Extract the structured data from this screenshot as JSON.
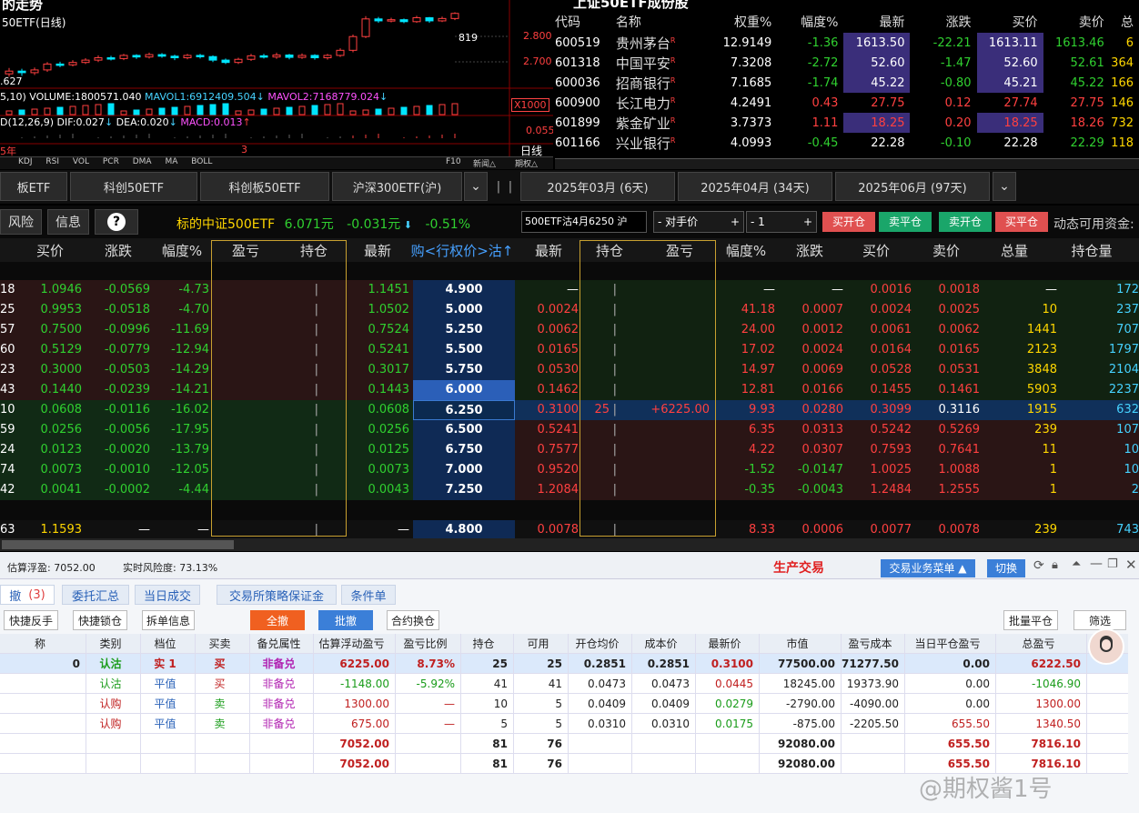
{
  "chart": {
    "title": "的走势",
    "subtitle": "50ETF(日线)",
    "price_labels": [
      "2.800",
      "2.700"
    ],
    "last_price_tag": "819",
    "low_label": ".627",
    "volume_text": "5,10) VOLUME:1800571.040",
    "mavol1_text": "MAVOL1:6912409.504",
    "mavol2_text": "MAVOL2:7168779.024",
    "multiplier": "X1000",
    "macd_prefix": "D(12,26,9)",
    "dif_text": "DIF:0.027",
    "dea_text": "DEA:0.020",
    "macd_text": "MACD:0.013",
    "macd_level": "0.055",
    "year_label": "5年",
    "month_label": "3",
    "period_label": "日线",
    "indicator_tabs": [
      "KDJ",
      "RSI",
      "VOL",
      "PCR",
      "DMA",
      "MA",
      "BOLL"
    ],
    "f10_label": "F10",
    "news_label": "新闻△",
    "period_btn": "期权△",
    "candles": [
      {
        "o": 2.665,
        "c": 2.672,
        "h": 2.68,
        "l": 2.658
      },
      {
        "o": 2.672,
        "c": 2.668,
        "h": 2.678,
        "l": 2.66
      },
      {
        "o": 2.668,
        "c": 2.675,
        "h": 2.681,
        "l": 2.662
      },
      {
        "o": 2.675,
        "c": 2.69,
        "h": 2.695,
        "l": 2.67
      },
      {
        "o": 2.69,
        "c": 2.688,
        "h": 2.696,
        "l": 2.682
      },
      {
        "o": 2.688,
        "c": 2.694,
        "h": 2.7,
        "l": 2.684
      },
      {
        "o": 2.694,
        "c": 2.7,
        "h": 2.705,
        "l": 2.69
      },
      {
        "o": 2.7,
        "c": 2.706,
        "h": 2.712,
        "l": 2.695
      },
      {
        "o": 2.706,
        "c": 2.704,
        "h": 2.711,
        "l": 2.699
      },
      {
        "o": 2.704,
        "c": 2.712,
        "h": 2.716,
        "l": 2.7
      },
      {
        "o": 2.712,
        "c": 2.708,
        "h": 2.715,
        "l": 2.703
      },
      {
        "o": 2.708,
        "c": 2.714,
        "h": 2.719,
        "l": 2.704
      },
      {
        "o": 2.714,
        "c": 2.71,
        "h": 2.718,
        "l": 2.706
      },
      {
        "o": 2.71,
        "c": 2.706,
        "h": 2.714,
        "l": 2.7
      },
      {
        "o": 2.706,
        "c": 2.712,
        "h": 2.716,
        "l": 2.702
      },
      {
        "o": 2.712,
        "c": 2.709,
        "h": 2.716,
        "l": 2.704
      },
      {
        "o": 2.709,
        "c": 2.7,
        "h": 2.712,
        "l": 2.695
      },
      {
        "o": 2.7,
        "c": 2.694,
        "h": 2.704,
        "l": 2.69
      },
      {
        "o": 2.694,
        "c": 2.702,
        "h": 2.706,
        "l": 2.69
      },
      {
        "o": 2.702,
        "c": 2.711,
        "h": 2.716,
        "l": 2.698
      },
      {
        "o": 2.711,
        "c": 2.708,
        "h": 2.716,
        "l": 2.704
      },
      {
        "o": 2.708,
        "c": 2.713,
        "h": 2.719,
        "l": 2.703
      },
      {
        "o": 2.713,
        "c": 2.707,
        "h": 2.716,
        "l": 2.702
      },
      {
        "o": 2.707,
        "c": 2.712,
        "h": 2.717,
        "l": 2.703
      },
      {
        "o": 2.712,
        "c": 2.706,
        "h": 2.715,
        "l": 2.701
      },
      {
        "o": 2.706,
        "c": 2.712,
        "h": 2.716,
        "l": 2.701
      },
      {
        "o": 2.712,
        "c": 2.725,
        "h": 2.73,
        "l": 2.708
      },
      {
        "o": 2.725,
        "c": 2.76,
        "h": 2.765,
        "l": 2.72
      },
      {
        "o": 2.76,
        "c": 2.805,
        "h": 2.812,
        "l": 2.756
      },
      {
        "o": 2.805,
        "c": 2.8,
        "h": 2.81,
        "l": 2.795
      },
      {
        "o": 2.8,
        "c": 2.803,
        "h": 2.808,
        "l": 2.796
      },
      {
        "o": 2.803,
        "c": 2.798,
        "h": 2.806,
        "l": 2.794
      },
      {
        "o": 2.798,
        "c": 2.808,
        "h": 2.813,
        "l": 2.795
      },
      {
        "o": 2.808,
        "c": 2.8,
        "h": 2.81,
        "l": 2.795
      },
      {
        "o": 2.8,
        "c": 2.806,
        "h": 2.811,
        "l": 2.797
      },
      {
        "o": 2.806,
        "c": 2.819,
        "h": 2.822,
        "l": 2.802
      }
    ]
  },
  "stocks": {
    "header_title": "上证50ETF成份股",
    "columns": [
      "代码",
      "名称",
      "权重%",
      "幅度%",
      "最新",
      "涨跌",
      "买价",
      "卖价",
      "总"
    ],
    "rows": [
      {
        "code": "600519",
        "name": "贵州茅台",
        "w": "12.9149",
        "amp": "-1.36",
        "last": "1613.50",
        "chg": "-22.21",
        "bid": "1613.11",
        "ask": "1613.46",
        "tot": "6"
      },
      {
        "code": "601318",
        "name": "中国平安",
        "w": "7.3208",
        "amp": "-2.72",
        "last": "52.60",
        "chg": "-1.47",
        "bid": "52.60",
        "ask": "52.61",
        "tot": "364"
      },
      {
        "code": "600036",
        "name": "招商银行",
        "w": "7.1685",
        "amp": "-1.74",
        "last": "45.22",
        "chg": "-0.80",
        "bid": "45.21",
        "ask": "45.22",
        "tot": "166"
      },
      {
        "code": "600900",
        "name": "长江电力",
        "w": "4.2491",
        "amp": "0.43",
        "last": "27.75",
        "chg": "0.12",
        "bid": "27.74",
        "ask": "27.75",
        "tot": "146"
      },
      {
        "code": "601899",
        "name": "紫金矿业",
        "w": "3.7373",
        "amp": "1.11",
        "last": "18.25",
        "chg": "0.20",
        "bid": "18.25",
        "ask": "18.26",
        "tot": "732"
      },
      {
        "code": "601166",
        "name": "兴业银行",
        "w": "4.0993",
        "amp": "-0.45",
        "last": "22.28",
        "chg": "-0.10",
        "bid": "22.28",
        "ask": "22.29",
        "tot": "118"
      }
    ],
    "suffix": "R"
  },
  "tabs2": [
    "板ETF",
    "科创50ETF",
    "科创板50ETF",
    "沪深300ETF(沪)",
    "2025年03月 (6天)",
    "2025年04月 (34天)",
    "2025年06月 (97天)"
  ],
  "toolbar": {
    "risk": "风险",
    "info": "信息",
    "help": "?",
    "underlying_label": "标的",
    "underlying_name": "中证500ETF",
    "underlying_price": "6.071元",
    "underlying_chg": "-0.031元",
    "underlying_pct": "-0.51%",
    "contract": "500ETF沽4月6250 沪",
    "price_mode": "- 对手价",
    "qty": "- 1",
    "buy_open": "买开仓",
    "sell_close": "卖平仓",
    "sell_open": "卖开仓",
    "buy_close": "买平仓",
    "funds": "动态可用资金:"
  },
  "grid": {
    "headers_left": [
      "买价",
      "涨跌",
      "幅度%",
      "盈亏",
      "持仓",
      "最新"
    ],
    "strike_header": "购<行权价>沽↑",
    "headers_right": [
      "最新",
      "持仓",
      "盈亏",
      "幅度%",
      "涨跌",
      "买价",
      "卖价",
      "总量",
      "持仓量"
    ],
    "rows": [
      {
        "cb": "18",
        "b": "1.0946",
        "d": "-0.0569",
        "p": "-4.73",
        "cl": "1.1451",
        "k": "4.900",
        "pl": "—",
        "rp": "—",
        "rd": "—",
        "rb": "0.0016",
        "ra": "0.0018",
        "rv": "—",
        "ro": "172"
      },
      {
        "cb": "25",
        "b": "0.9953",
        "d": "-0.0518",
        "p": "-4.70",
        "cl": "1.0502",
        "k": "5.000",
        "pl": "0.0024",
        "rp": "41.18",
        "rd": "0.0007",
        "rb": "0.0024",
        "ra": "0.0025",
        "rv": "10",
        "ro": "237"
      },
      {
        "cb": "57",
        "b": "0.7500",
        "d": "-0.0996",
        "p": "-11.69",
        "cl": "0.7524",
        "k": "5.250",
        "pl": "0.0062",
        "rp": "24.00",
        "rd": "0.0012",
        "rb": "0.0061",
        "ra": "0.0062",
        "rv": "1441",
        "ro": "707"
      },
      {
        "cb": "60",
        "b": "0.5129",
        "d": "-0.0779",
        "p": "-12.94",
        "cl": "0.5241",
        "k": "5.500",
        "pl": "0.0165",
        "rp": "17.02",
        "rd": "0.0024",
        "rb": "0.0164",
        "ra": "0.0165",
        "rv": "2123",
        "ro": "1797"
      },
      {
        "cb": "23",
        "b": "0.3000",
        "d": "-0.0503",
        "p": "-14.29",
        "cl": "0.3017",
        "k": "5.750",
        "pl": "0.0530",
        "rp": "14.97",
        "rd": "0.0069",
        "rb": "0.0528",
        "ra": "0.0531",
        "rv": "3848",
        "ro": "2104"
      },
      {
        "cb": "43",
        "b": "0.1440",
        "d": "-0.0239",
        "p": "-14.21",
        "cl": "0.1443",
        "k": "6.000",
        "pl": "0.1462",
        "rp": "12.81",
        "rd": "0.0166",
        "rb": "0.1455",
        "ra": "0.1461",
        "rv": "5903",
        "ro": "2237"
      },
      {
        "cb": "10",
        "b": "0.0608",
        "d": "-0.0116",
        "p": "-16.02",
        "cl": "0.0608",
        "k": "6.250",
        "pl": "0.3100",
        "pos": "25",
        "pnl": "+6225.00",
        "rp": "9.93",
        "rd": "0.0280",
        "rb": "0.3099",
        "ra": "0.3116",
        "rv": "1915",
        "ro": "632"
      },
      {
        "cb": "59",
        "b": "0.0256",
        "d": "-0.0056",
        "p": "-17.95",
        "cl": "0.0256",
        "k": "6.500",
        "pl": "0.5241",
        "rp": "6.35",
        "rd": "0.0313",
        "rb": "0.5242",
        "ra": "0.5269",
        "rv": "239",
        "ro": "107"
      },
      {
        "cb": "24",
        "b": "0.0123",
        "d": "-0.0020",
        "p": "-13.79",
        "cl": "0.0125",
        "k": "6.750",
        "pl": "0.7577",
        "rp": "4.22",
        "rd": "0.0307",
        "rb": "0.7593",
        "ra": "0.7641",
        "rv": "11",
        "ro": "10"
      },
      {
        "cb": "74",
        "b": "0.0073",
        "d": "-0.0010",
        "p": "-12.05",
        "cl": "0.0073",
        "k": "7.000",
        "pl": "0.9520",
        "rp": "-1.52",
        "rd": "-0.0147",
        "rb": "1.0025",
        "ra": "1.0088",
        "rv": "1",
        "ro": "10"
      },
      {
        "cb": "42",
        "b": "0.0041",
        "d": "-0.0002",
        "p": "-4.44",
        "cl": "0.0043",
        "k": "7.250",
        "pl": "1.2084",
        "rp": "-0.35",
        "rd": "-0.0043",
        "rb": "1.2484",
        "ra": "1.2555",
        "rv": "1",
        "ro": "2"
      },
      {
        "cb": "63",
        "b": "1.1593",
        "d": "—",
        "p": "—",
        "cl": "—",
        "k": "4.800",
        "pl": "0.0078",
        "rp": "8.33",
        "rd": "0.0006",
        "rb": "0.0077",
        "ra": "0.0078",
        "rv": "239",
        "ro": "743"
      }
    ]
  },
  "bottom": {
    "est_label": "估算浮盈:",
    "est_value": "7052.00",
    "risk_label": "实时风险度:",
    "risk_value": "73.13%",
    "title": "生产交易",
    "menu_btn": "交易业务菜单 ▲",
    "switch_btn": "切换",
    "tabs": [
      "撤",
      "(3)",
      "委托汇总",
      "当日成交",
      "交易所策略保证金",
      "条件单"
    ],
    "actions": [
      "快捷反手",
      "快捷锁仓",
      "拆单信息",
      "全撤",
      "批撤",
      "合约换仓",
      "批量平仓",
      "筛选"
    ],
    "columns": [
      "称",
      "类别",
      "档位",
      "买卖",
      "备兑属性",
      "估算浮动盈亏",
      "盈亏比例",
      "持仓",
      "可用",
      "开仓均价",
      "成本价",
      "最新价",
      "市值",
      "盈亏成本",
      "当日平仓盈亏",
      "总盈亏"
    ],
    "rows": [
      [
        "0",
        "认沽",
        "实 1",
        "买",
        "非备兑",
        "6225.00",
        "8.73%",
        "25",
        "25",
        "0.2851",
        "0.2851",
        "0.3100",
        "77500.00",
        "71277.50",
        "0.00",
        "6222.50"
      ],
      [
        "",
        "认沽",
        "平值",
        "买",
        "非备兑",
        "-1148.00",
        "-5.92%",
        "41",
        "41",
        "0.0473",
        "0.0473",
        "0.0445",
        "18245.00",
        "19373.90",
        "0.00",
        "-1046.90"
      ],
      [
        "",
        "认购",
        "平值",
        "卖",
        "非备兑",
        "1300.00",
        "—",
        "10",
        "5",
        "0.0409",
        "0.0409",
        "0.0279",
        "-2790.00",
        "-4090.00",
        "0.00",
        "1300.00"
      ],
      [
        "",
        "认购",
        "平值",
        "卖",
        "非备兑",
        "675.00",
        "—",
        "5",
        "5",
        "0.0310",
        "0.0310",
        "0.0175",
        "-875.00",
        "-2205.50",
        "655.50",
        "1340.50"
      ],
      [
        "",
        "",
        "",
        "",
        "",
        "7052.00",
        "",
        "81",
        "76",
        "",
        "",
        "",
        "92080.00",
        "",
        "655.50",
        "7816.10"
      ],
      [
        "",
        "",
        "",
        "",
        "",
        "7052.00",
        "",
        "81",
        "76",
        "",
        "",
        "",
        "92080.00",
        "",
        "655.50",
        "7816.10"
      ]
    ],
    "watermark": "@期权酱1号"
  }
}
